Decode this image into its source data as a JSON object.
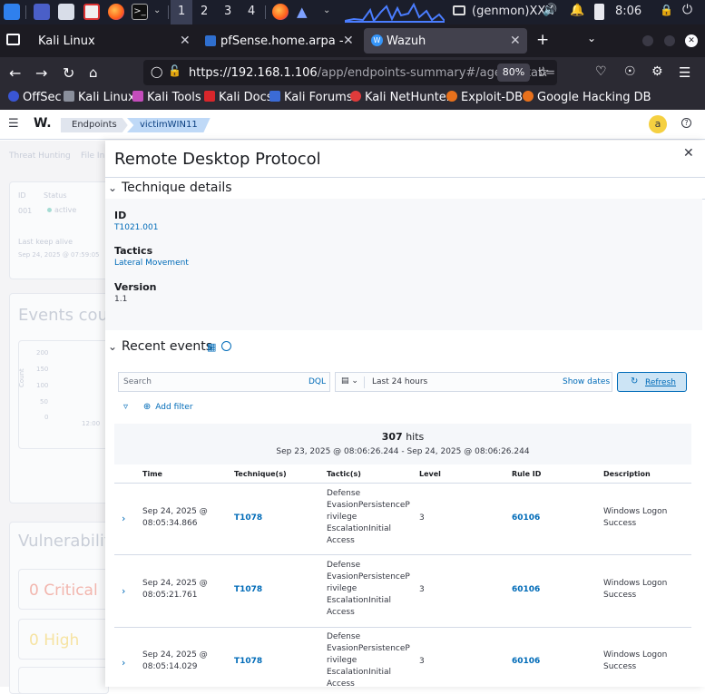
{
  "taskbar": {
    "workspaces": [
      "1",
      "2",
      "3",
      "4"
    ],
    "user": "(genmon)XXX",
    "time": "8:06"
  },
  "browser": {
    "tabs": [
      {
        "title": "Kali Linux"
      },
      {
        "title": "pfSense.home.arpa - Stat"
      },
      {
        "title": "Wazuh"
      }
    ],
    "url_main": "https://192.168.1.106",
    "url_path": "/app/endpoints-summary#/agents?tab=",
    "zoom": "80%",
    "bookmarks": [
      "OffSec",
      "Kali Linux",
      "Kali Tools",
      "Kali Docs",
      "Kali Forums",
      "Kali NetHunter",
      "Exploit-DB",
      "Google Hacking DB"
    ]
  },
  "wazuh": {
    "logo": "W.",
    "breadcrumbs": [
      "Endpoints",
      "victimWIN11"
    ],
    "avatar": "a"
  },
  "background": {
    "tabs": [
      "Threat Hunting",
      "File In"
    ],
    "agent_fields": {
      "id_label": "ID",
      "id": "001",
      "status_label": "Status",
      "status": "active"
    },
    "last_keep_alive_label": "Last keep alive",
    "last_keep_alive": "Sep 24, 2025 @ 07:59:05",
    "events_count": "Events coun",
    "y_ticks": [
      "200",
      "150",
      "100",
      "50",
      "0"
    ],
    "y_label": "Count",
    "x_tick": "12:00",
    "vulnerability": "Vulnerabilit",
    "critical": "0 Critical",
    "high": "0 High"
  },
  "flyout": {
    "title": "Remote Desktop Protocol",
    "technique_details": "Technique details",
    "id_label": "ID",
    "id_value": "T1021.001",
    "tactics_label": "Tactics",
    "tactics_value": "Lateral Movement",
    "version_label": "Version",
    "version_value": "1.1",
    "recent_events": "Recent events",
    "search_placeholder": "Search",
    "dql": "DQL",
    "date_range": "Last 24 hours",
    "show_dates": "Show dates",
    "refresh": "Refresh",
    "add_filter": "Add filter",
    "hits_count": "307",
    "hits_label": "hits",
    "hits_range": "Sep 23, 2025 @ 08:06:26.244 - Sep 24, 2025 @ 08:06:26.244",
    "columns": [
      "Time",
      "Technique(s)",
      "Tactic(s)",
      "Level",
      "Rule ID",
      "Description"
    ],
    "rows": [
      {
        "time1": "Sep 24, 2025 @",
        "time2": "08:05:34.866",
        "technique": "T1078",
        "tactic1": "Defense",
        "tactic2": "EvasionPersistenceP",
        "tactic3": "rivilege",
        "tactic4": "EscalationInitial",
        "tactic5": "Access",
        "level": "3",
        "rule": "60106",
        "desc1": "Windows Logon",
        "desc2": "Success"
      },
      {
        "time1": "Sep 24, 2025 @",
        "time2": "08:05:21.761",
        "technique": "T1078",
        "tactic1": "Defense",
        "tactic2": "EvasionPersistenceP",
        "tactic3": "rivilege",
        "tactic4": "EscalationInitial",
        "tactic5": "Access",
        "level": "3",
        "rule": "60106",
        "desc1": "Windows Logon",
        "desc2": "Success"
      },
      {
        "time1": "Sep 24, 2025 @",
        "time2": "08:05:14.029",
        "technique": "T1078",
        "tactic1": "Defense",
        "tactic2": "EvasionPersistenceP",
        "tactic3": "rivilege",
        "tactic4": "EscalationInitial",
        "tactic5": "Access",
        "level": "3",
        "rule": "60106",
        "desc1": "Windows Logon",
        "desc2": "Success"
      }
    ]
  },
  "colors": {
    "accent": "#006bb8",
    "panel": "#1b1e2b",
    "refresh_bg": "#cce4f5"
  }
}
